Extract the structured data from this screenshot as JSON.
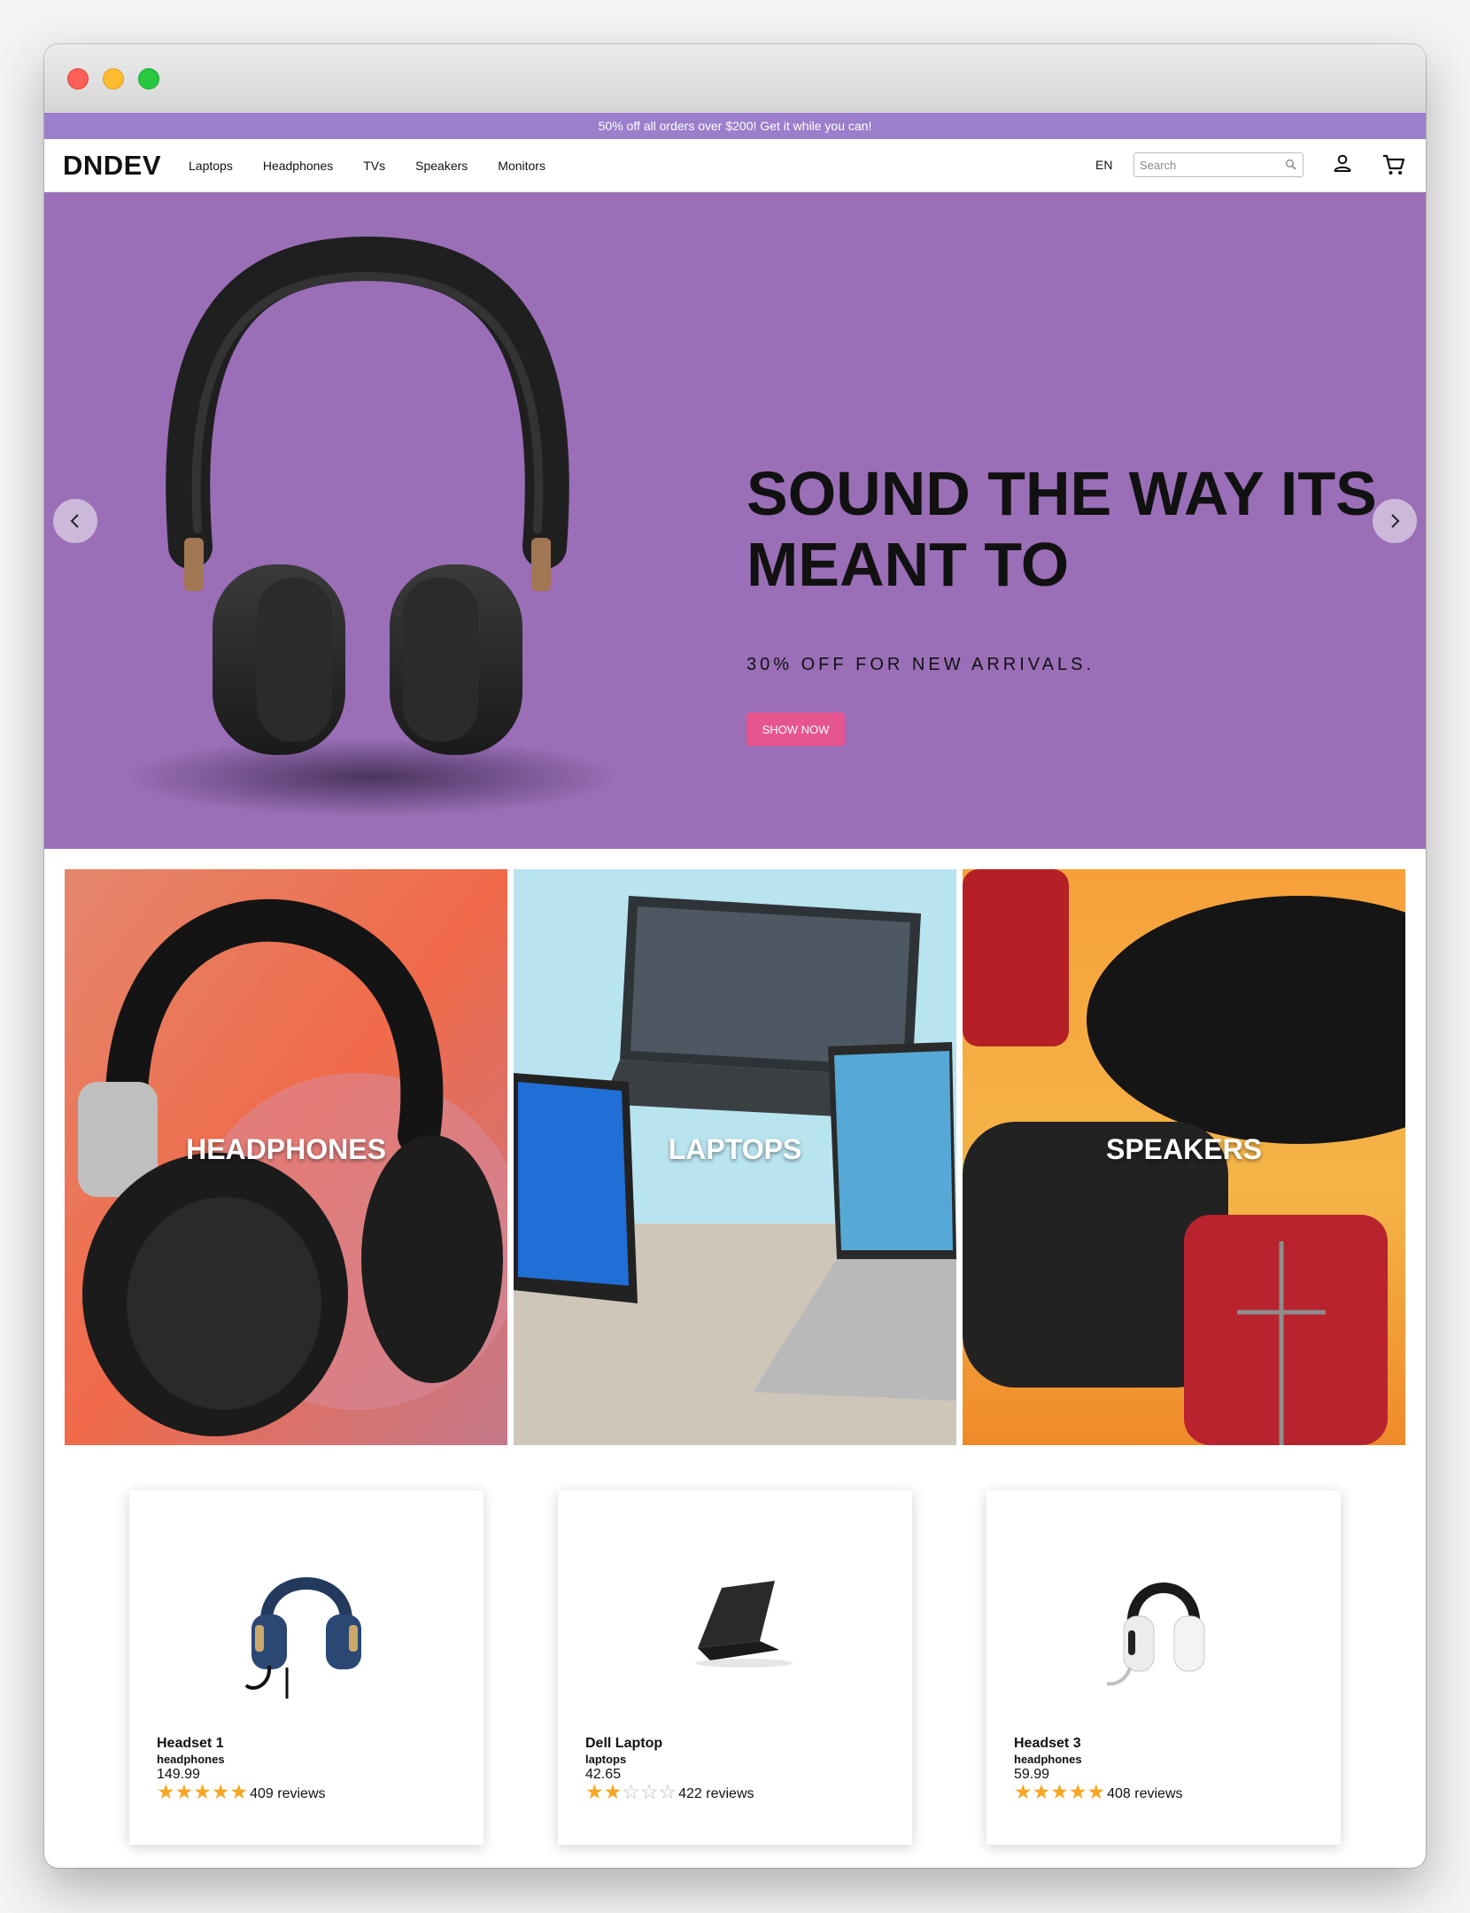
{
  "promo": {
    "text": "50% off all orders over $200! Get it while you can!"
  },
  "nav": {
    "logo": "DNDEV",
    "links": [
      "Laptops",
      "Headphones",
      "TVs",
      "Speakers",
      "Monitors"
    ],
    "language": "EN",
    "search_placeholder": "Search",
    "search_value": ""
  },
  "hero": {
    "title": "SOUND THE WAY ITS MEANT TO",
    "subtitle": "30% OFF FOR NEW ARRIVALS.",
    "button": "SHOW NOW",
    "background_color": "#9a6fb7",
    "button_color": "#e6558f"
  },
  "categories": [
    {
      "label": "HEADPHONES"
    },
    {
      "label": "LAPTOPS"
    },
    {
      "label": "SPEAKERS"
    }
  ],
  "products": [
    {
      "name": "Headset 1",
      "category": "headphones",
      "price": "149.99",
      "rating": 5,
      "reviews": "409 reviews"
    },
    {
      "name": "Dell Laptop",
      "category": "laptops",
      "price": "42.65",
      "rating": 2,
      "reviews": "422 reviews"
    },
    {
      "name": "Headset 3",
      "category": "headphones",
      "price": "59.99",
      "rating": 5,
      "reviews": "408 reviews"
    }
  ],
  "colors": {
    "promo_bar": "#9b7fcb",
    "star": "#f5a623"
  }
}
